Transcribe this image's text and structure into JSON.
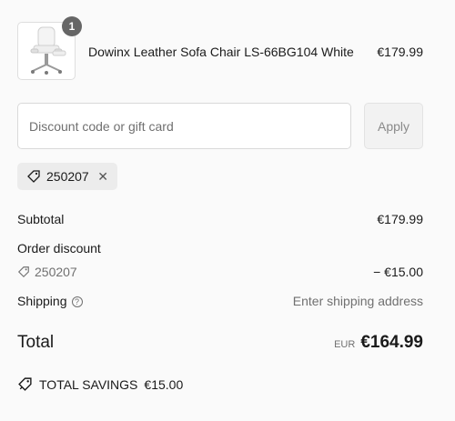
{
  "product": {
    "quantity": "1",
    "name": "Dowinx Leather Sofa Chair LS-66BG104 White",
    "price": "€179.99",
    "image": "office-chair-image"
  },
  "discount": {
    "placeholder": "Discount code or gift card",
    "apply_label": "Apply",
    "applied_code": "250207",
    "remove_glyph": "✕"
  },
  "summary": {
    "subtotal_label": "Subtotal",
    "subtotal_value": "€179.99",
    "order_discount_label": "Order discount",
    "discount_code": "250207",
    "discount_value": "− €15.00",
    "shipping_label": "Shipping",
    "shipping_value": "Enter shipping address",
    "total_label": "Total",
    "total_currency": "EUR",
    "total_value": "€164.99",
    "savings_label": "TOTAL SAVINGS",
    "savings_value": "€15.00"
  },
  "colors": {
    "badge": "#666666",
    "muted_text": "#707070",
    "tag_bg": "#ececec"
  }
}
